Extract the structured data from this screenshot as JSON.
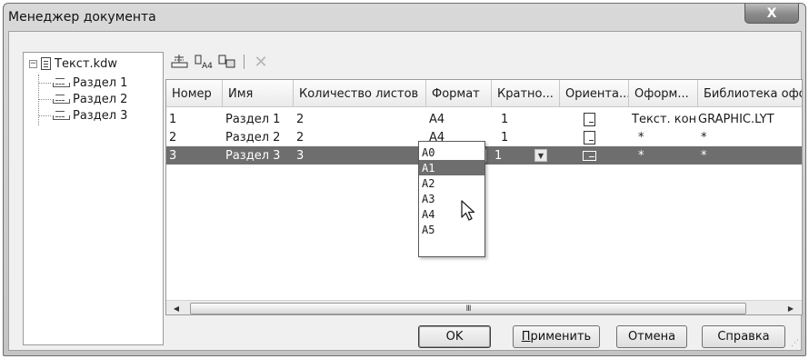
{
  "window": {
    "title": "Менеджер документа",
    "close_label": "X"
  },
  "tree": {
    "root": {
      "label": "Текст.kdw",
      "expander": "−",
      "icon": "document-icon"
    },
    "children": [
      {
        "label": "Раздел 1",
        "icon": "sheet-section-icon"
      },
      {
        "label": "Раздел 2",
        "icon": "sheet-section-icon"
      },
      {
        "label": "Раздел 3",
        "icon": "sheet-section-icon"
      }
    ]
  },
  "toolbar": {
    "icons": [
      "add-section-icon",
      "format-a4-icon",
      "sheet-properties-icon",
      "delete-icon"
    ]
  },
  "table": {
    "columns": [
      "Номер",
      "Имя",
      "Количество листов",
      "Формат",
      "Кратно...",
      "Ориента...",
      "Оформ...",
      "Библиотека оформ"
    ],
    "rows": [
      {
        "number": "1",
        "name": "Раздел 1",
        "sheets": "2",
        "format": "A4",
        "multiple": "1",
        "orientation": "portrait",
        "style": "Текст. кон",
        "library": "GRAPHIC.LYT",
        "selected": false
      },
      {
        "number": "2",
        "name": "Раздел 2",
        "sheets": "2",
        "format": "A4",
        "multiple": "1",
        "orientation": "portrait",
        "style": "*",
        "library": "*",
        "selected": false
      },
      {
        "number": "3",
        "name": "Раздел 3",
        "sheets": "3",
        "format": "A1",
        "multiple": "1",
        "orientation": "landscape",
        "style": "*",
        "library": "*",
        "selected": true
      }
    ]
  },
  "format_dropdown": {
    "options": [
      "A0",
      "A1",
      "A2",
      "A3",
      "A4",
      "A5"
    ],
    "highlighted": "A1"
  },
  "scrollbar": {
    "left_arrow": "◀",
    "right_arrow": "▶",
    "grip": "III"
  },
  "buttons": {
    "ok": "OK",
    "apply_first": "П",
    "apply_rest": "рименить",
    "cancel": "Отмена",
    "help": "Справка"
  },
  "colors": {
    "selection": "#6e6e6e",
    "dialog_bg": "#f0f0f0"
  }
}
